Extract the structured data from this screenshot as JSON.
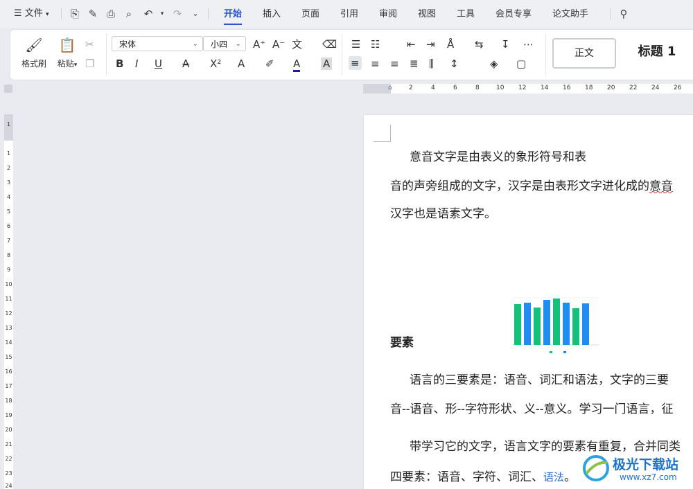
{
  "menubar": {
    "menu_label": "文件",
    "tabs": [
      "开始",
      "插入",
      "页面",
      "引用",
      "审阅",
      "视图",
      "工具",
      "会员专享",
      "论文助手"
    ]
  },
  "ribbon": {
    "format_painter": "格式刷",
    "paste": "粘贴",
    "font_name": "宋体",
    "font_size": "小四",
    "style_normal": "正文",
    "style_heading": "标题 1"
  },
  "ruler": {
    "h_ticks": [
      "2",
      "4",
      "6",
      "8",
      "10",
      "12",
      "14",
      "16",
      "18",
      "20",
      "22",
      "24",
      "26"
    ],
    "v_ticks": [
      "1",
      "1",
      "2",
      "3",
      "4",
      "5",
      "6",
      "7",
      "8",
      "9",
      "10",
      "11",
      "12",
      "13",
      "14",
      "15",
      "16",
      "17",
      "18",
      "19",
      "20",
      "21",
      "22",
      "23",
      "24"
    ]
  },
  "document": {
    "line1": "意音文字是由表义的象形符号和表",
    "line2a": "音的声旁组成的文字，汉字是由表形文字进化成的",
    "line2b": "意音",
    "line3": "汉字也是语素文字。",
    "heading": "要素",
    "p2_line1": "语言的三要素是：语音、词汇和语法，文字的三要",
    "p2_line2": "音--语音、形--字符形状、义--意义。学习一门语言，征",
    "p3_line1": "带学习它的文字，语言文字的要素有重复，合并同类",
    "p3_line2a": "四要素：语音、字符、词汇、",
    "p3_line2b": "语法",
    "p3_line2c": "。"
  },
  "watermark": {
    "text": "极光下载站",
    "url": "www.xz7.com"
  },
  "colors": {
    "accent": "#2a55c7",
    "chart_green": "#15c07a",
    "chart_blue": "#1e8ef0"
  }
}
